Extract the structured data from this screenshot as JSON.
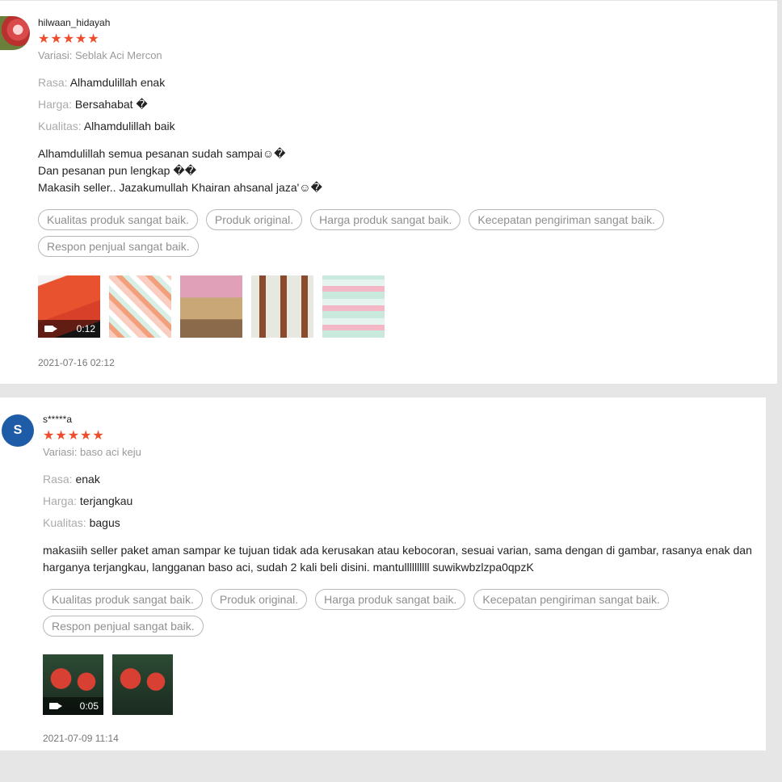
{
  "reviews": [
    {
      "username": "hilwaan_hidayah",
      "stars": "★★★★★",
      "variation": "Variasi: Seblak Aci Mercon",
      "attrs": [
        {
          "key": "Rasa:",
          "value": "Alhamdulillah enak"
        },
        {
          "key": "Harga:",
          "value": "Bersahabat �"
        },
        {
          "key": "Kualitas:",
          "value": "Alhamdulillah baik"
        }
      ],
      "body": "Alhamdulillah semua pesanan sudah sampai☺�\nDan pesanan pun lengkap ��\nMakasih seller.. Jazakumullah Khairan ahsanal jaza'☺�",
      "tags": [
        "Kualitas produk sangat baik.",
        "Produk original.",
        "Harga produk sangat baik.",
        "Kecepatan pengiriman sangat baik.",
        "Respon penjual sangat baik."
      ],
      "video_duration": "0:12",
      "date": "2021-07-16 02:12"
    },
    {
      "username": "s*****a",
      "avatar_letter": "S",
      "stars": "★★★★★",
      "variation": "Variasi: baso aci keju",
      "attrs": [
        {
          "key": "Rasa:",
          "value": "enak"
        },
        {
          "key": "Harga:",
          "value": "terjangkau"
        },
        {
          "key": "Kualitas:",
          "value": "bagus"
        }
      ],
      "body": "makasiih seller paket aman sampar ke tujuan tidak ada kerusakan atau kebocoran, sesuai varian, sama dengan di gambar, rasanya enak dan harganya terjangkau, langganan baso aci, sudah 2 kali beli disini. mantullllllllll suwikwbzlzpa0qpzK",
      "tags": [
        "Kualitas produk sangat baik.",
        "Produk original.",
        "Harga produk sangat baik.",
        "Kecepatan pengiriman sangat baik.",
        "Respon penjual sangat baik."
      ],
      "video_duration": "0:05",
      "date": "2021-07-09 11:14"
    }
  ],
  "colors": {
    "star": "#ee4d2d",
    "avatar_bg": "#1f5ca8"
  },
  "icons": {
    "video": "video-camera-icon",
    "star": "star-icon"
  }
}
